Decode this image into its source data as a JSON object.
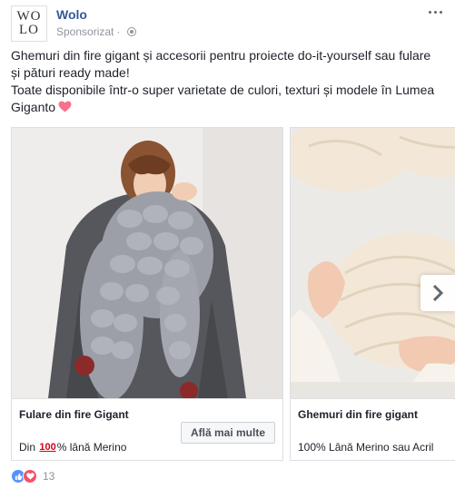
{
  "header": {
    "avatar_line1": "WO",
    "avatar_line2": "LO",
    "page_name": "Wolo",
    "sponsored": "Sponsorizat"
  },
  "post": {
    "line1": "Ghemuri din fire gigant și accesorii pentru proiecte do-it-yourself sau fulare",
    "line2": "și pături ready made!",
    "line3": "Toate disponibile într-o super varietate de culori, texturi și modele în Lumea",
    "line4": "Giganto"
  },
  "cards": [
    {
      "title": "Fulare din fire Gigant",
      "desc_prefix": "Din",
      "desc_emoji": "100",
      "desc_suffix": "% lână Merino",
      "cta": "Află mai multe"
    },
    {
      "title": "Ghemuri din fire gigant",
      "desc": "100% Lână Merino sau Acril"
    }
  ],
  "reactions": {
    "count": "13"
  },
  "colors": {
    "link": "#365899",
    "like": "#5890ff",
    "love": "#f25268",
    "muted": "#90949c"
  }
}
